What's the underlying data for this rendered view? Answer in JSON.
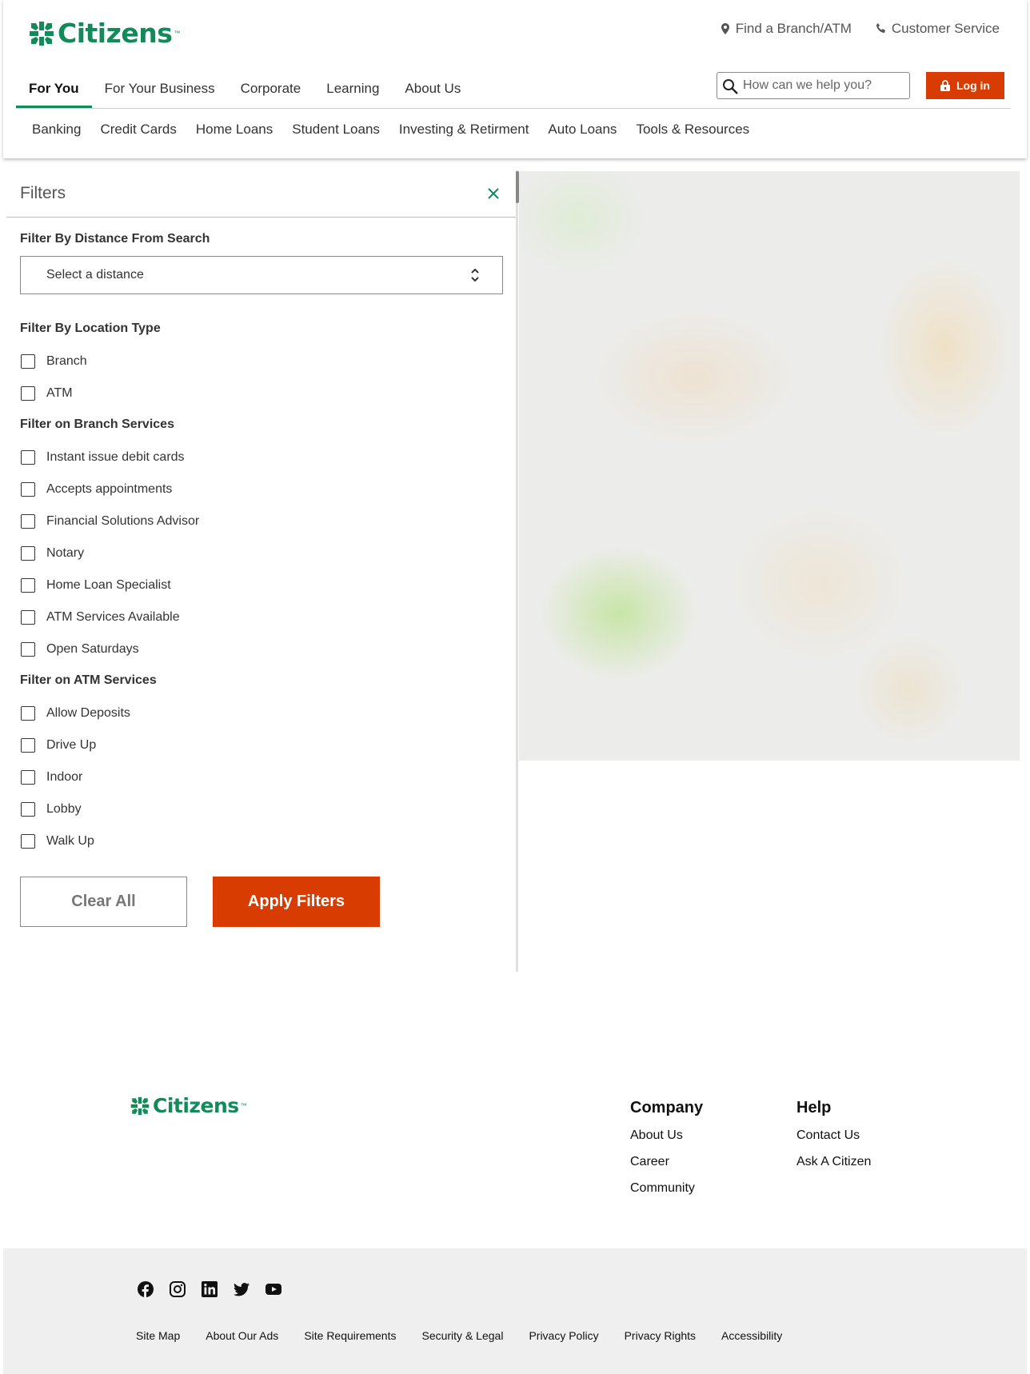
{
  "brand": {
    "name": "Citizens",
    "tm": "™",
    "color": "#138a5a",
    "accent": "#d93c00"
  },
  "utility": {
    "find_branch": "Find a Branch/ATM",
    "customer_service": "Customer Service"
  },
  "primary_nav": [
    "For You",
    "For Your Business",
    "Corporate",
    "Learning",
    "About Us"
  ],
  "search": {
    "placeholder": "How can we help you?"
  },
  "login": {
    "label": "Log in"
  },
  "secondary_nav": [
    "Banking",
    "Credit Cards",
    "Home Loans",
    "Student Loans",
    "Investing & Retirment",
    "Auto Loans",
    "Tools & Resources"
  ],
  "filters": {
    "title": "Filters",
    "distance": {
      "label": "Filter By Distance From Search",
      "value": "Select a distance"
    },
    "location_type": {
      "label": "Filter By Location Type",
      "options": [
        "Branch",
        "ATM"
      ]
    },
    "branch_services": {
      "label": "Filter on Branch Services",
      "options": [
        "Instant issue debit cards",
        "Accepts appointments",
        "Financial Solutions Advisor",
        "Notary",
        "Home Loan Specialist",
        "ATM Services Available",
        "Open Saturdays"
      ]
    },
    "atm_services": {
      "label": "Filter on ATM Services",
      "options": [
        "Allow Deposits",
        "Drive Up",
        "Indoor",
        "Lobby",
        "Walk Up"
      ]
    },
    "clear_label": "Clear All",
    "apply_label": "Apply Filters"
  },
  "footer": {
    "company": {
      "title": "Company",
      "links": [
        "About Us",
        "Career",
        "Community"
      ]
    },
    "help": {
      "title": "Help",
      "links": [
        "Contact Us",
        "Ask A Citizen"
      ]
    },
    "social": [
      "facebook-icon",
      "instagram-icon",
      "linkedin-icon",
      "twitter-icon",
      "youtube-icon"
    ],
    "legal": [
      "Site Map",
      "About Our Ads",
      "Site Requirements",
      "Security & Legal",
      "Privacy Policy",
      "Privacy Rights",
      "Accessibility"
    ]
  }
}
